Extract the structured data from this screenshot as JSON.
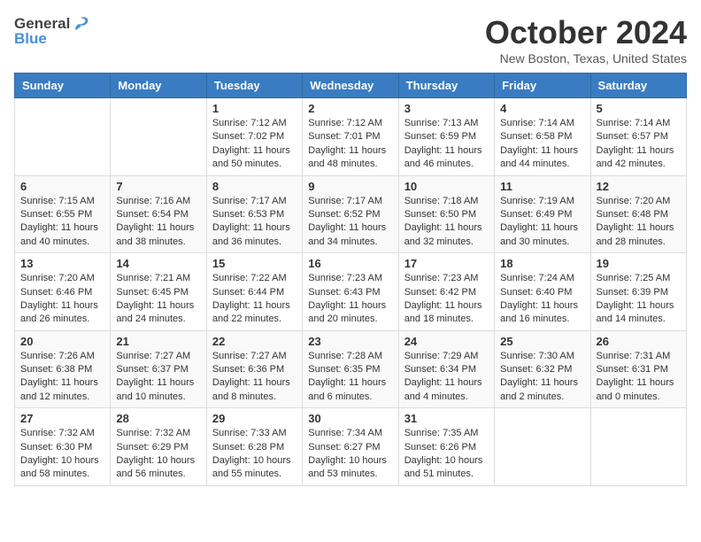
{
  "header": {
    "logo_general": "General",
    "logo_blue": "Blue",
    "month": "October 2024",
    "location": "New Boston, Texas, United States"
  },
  "days_of_week": [
    "Sunday",
    "Monday",
    "Tuesday",
    "Wednesday",
    "Thursday",
    "Friday",
    "Saturday"
  ],
  "weeks": [
    [
      {
        "day": "",
        "info": ""
      },
      {
        "day": "",
        "info": ""
      },
      {
        "day": "1",
        "info": "Sunrise: 7:12 AM\nSunset: 7:02 PM\nDaylight: 11 hours and 50 minutes."
      },
      {
        "day": "2",
        "info": "Sunrise: 7:12 AM\nSunset: 7:01 PM\nDaylight: 11 hours and 48 minutes."
      },
      {
        "day": "3",
        "info": "Sunrise: 7:13 AM\nSunset: 6:59 PM\nDaylight: 11 hours and 46 minutes."
      },
      {
        "day": "4",
        "info": "Sunrise: 7:14 AM\nSunset: 6:58 PM\nDaylight: 11 hours and 44 minutes."
      },
      {
        "day": "5",
        "info": "Sunrise: 7:14 AM\nSunset: 6:57 PM\nDaylight: 11 hours and 42 minutes."
      }
    ],
    [
      {
        "day": "6",
        "info": "Sunrise: 7:15 AM\nSunset: 6:55 PM\nDaylight: 11 hours and 40 minutes."
      },
      {
        "day": "7",
        "info": "Sunrise: 7:16 AM\nSunset: 6:54 PM\nDaylight: 11 hours and 38 minutes."
      },
      {
        "day": "8",
        "info": "Sunrise: 7:17 AM\nSunset: 6:53 PM\nDaylight: 11 hours and 36 minutes."
      },
      {
        "day": "9",
        "info": "Sunrise: 7:17 AM\nSunset: 6:52 PM\nDaylight: 11 hours and 34 minutes."
      },
      {
        "day": "10",
        "info": "Sunrise: 7:18 AM\nSunset: 6:50 PM\nDaylight: 11 hours and 32 minutes."
      },
      {
        "day": "11",
        "info": "Sunrise: 7:19 AM\nSunset: 6:49 PM\nDaylight: 11 hours and 30 minutes."
      },
      {
        "day": "12",
        "info": "Sunrise: 7:20 AM\nSunset: 6:48 PM\nDaylight: 11 hours and 28 minutes."
      }
    ],
    [
      {
        "day": "13",
        "info": "Sunrise: 7:20 AM\nSunset: 6:46 PM\nDaylight: 11 hours and 26 minutes."
      },
      {
        "day": "14",
        "info": "Sunrise: 7:21 AM\nSunset: 6:45 PM\nDaylight: 11 hours and 24 minutes."
      },
      {
        "day": "15",
        "info": "Sunrise: 7:22 AM\nSunset: 6:44 PM\nDaylight: 11 hours and 22 minutes."
      },
      {
        "day": "16",
        "info": "Sunrise: 7:23 AM\nSunset: 6:43 PM\nDaylight: 11 hours and 20 minutes."
      },
      {
        "day": "17",
        "info": "Sunrise: 7:23 AM\nSunset: 6:42 PM\nDaylight: 11 hours and 18 minutes."
      },
      {
        "day": "18",
        "info": "Sunrise: 7:24 AM\nSunset: 6:40 PM\nDaylight: 11 hours and 16 minutes."
      },
      {
        "day": "19",
        "info": "Sunrise: 7:25 AM\nSunset: 6:39 PM\nDaylight: 11 hours and 14 minutes."
      }
    ],
    [
      {
        "day": "20",
        "info": "Sunrise: 7:26 AM\nSunset: 6:38 PM\nDaylight: 11 hours and 12 minutes."
      },
      {
        "day": "21",
        "info": "Sunrise: 7:27 AM\nSunset: 6:37 PM\nDaylight: 11 hours and 10 minutes."
      },
      {
        "day": "22",
        "info": "Sunrise: 7:27 AM\nSunset: 6:36 PM\nDaylight: 11 hours and 8 minutes."
      },
      {
        "day": "23",
        "info": "Sunrise: 7:28 AM\nSunset: 6:35 PM\nDaylight: 11 hours and 6 minutes."
      },
      {
        "day": "24",
        "info": "Sunrise: 7:29 AM\nSunset: 6:34 PM\nDaylight: 11 hours and 4 minutes."
      },
      {
        "day": "25",
        "info": "Sunrise: 7:30 AM\nSunset: 6:32 PM\nDaylight: 11 hours and 2 minutes."
      },
      {
        "day": "26",
        "info": "Sunrise: 7:31 AM\nSunset: 6:31 PM\nDaylight: 11 hours and 0 minutes."
      }
    ],
    [
      {
        "day": "27",
        "info": "Sunrise: 7:32 AM\nSunset: 6:30 PM\nDaylight: 10 hours and 58 minutes."
      },
      {
        "day": "28",
        "info": "Sunrise: 7:32 AM\nSunset: 6:29 PM\nDaylight: 10 hours and 56 minutes."
      },
      {
        "day": "29",
        "info": "Sunrise: 7:33 AM\nSunset: 6:28 PM\nDaylight: 10 hours and 55 minutes."
      },
      {
        "day": "30",
        "info": "Sunrise: 7:34 AM\nSunset: 6:27 PM\nDaylight: 10 hours and 53 minutes."
      },
      {
        "day": "31",
        "info": "Sunrise: 7:35 AM\nSunset: 6:26 PM\nDaylight: 10 hours and 51 minutes."
      },
      {
        "day": "",
        "info": ""
      },
      {
        "day": "",
        "info": ""
      }
    ]
  ]
}
